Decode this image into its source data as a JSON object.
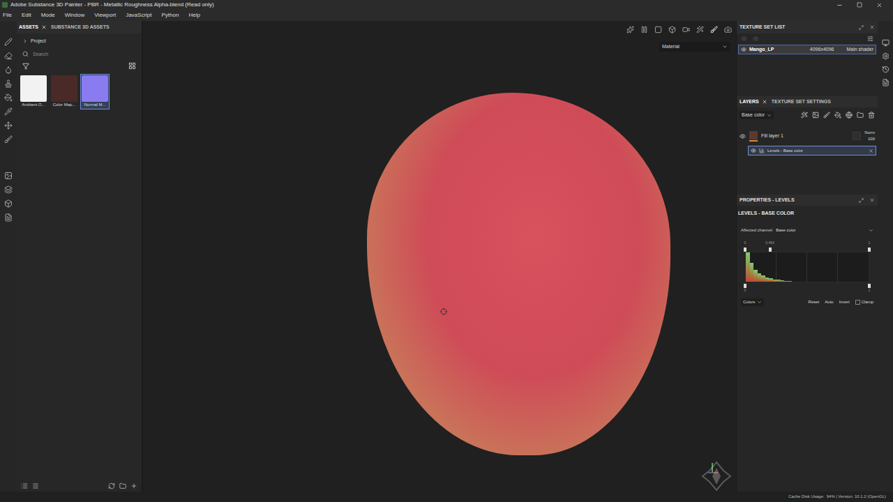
{
  "window": {
    "title": "Adobe Substance 3D Painter - PBR - Metallic Roughness Alpha-blend (Read only)"
  },
  "menu": [
    "File",
    "Edit",
    "Mode",
    "Window",
    "Viewport",
    "JavaScript",
    "Python",
    "Help"
  ],
  "assets_panel": {
    "tabs": [
      {
        "label": "ASSETS",
        "selected": true,
        "closable": true
      },
      {
        "label": "SUBSTANCE 3D ASSETS",
        "selected": false,
        "closable": false
      }
    ],
    "tree": {
      "label": "Project",
      "expanded": false
    },
    "search": {
      "placeholder": "Search"
    },
    "items": [
      {
        "label": "Ambient O...",
        "selected": false,
        "color": "#f2f2f2"
      },
      {
        "label": "Color Map...",
        "selected": false,
        "color": "#4a2a26"
      },
      {
        "label": "Normal M...",
        "selected": true,
        "color": "#8a7cf0"
      }
    ]
  },
  "viewport": {
    "mode": "Material"
  },
  "texture_set_list": {
    "title": "TEXTURE SET LIST",
    "rows": [
      {
        "name": "Mango_LP",
        "resolution": "4096x4096",
        "shader": "Main shader",
        "visible": true,
        "selected": true
      }
    ]
  },
  "layers": {
    "tabs": [
      {
        "label": "LAYERS",
        "selected": true,
        "closable": true
      },
      {
        "label": "TEXTURE SET SETTINGS",
        "selected": false,
        "closable": false
      }
    ],
    "channel": "Base color",
    "items": [
      {
        "kind": "layer",
        "name": "Fill layer 1",
        "visible": true,
        "blend": "Norm",
        "opacity": "100",
        "selected": false
      },
      {
        "kind": "effect",
        "name": "Levels - Base color",
        "visible": true,
        "selected": true
      }
    ]
  },
  "properties": {
    "title": "PROPERTIES - LEVELS",
    "heading": "LEVELS - BASE COLOR",
    "affected_channel_label": "Affected channel:",
    "affected_channel": "Base color",
    "input_markers": [
      {
        "label": "0",
        "level": 0
      },
      {
        "label": "0.454",
        "level": 0.2
      },
      {
        "label": "1",
        "level": 1
      }
    ],
    "output_markers": [
      {
        "label": "0",
        "level": 0
      },
      {
        "label": "1",
        "level": 1
      }
    ],
    "histogram": [
      1,
      0.62,
      0.4,
      0.28,
      0.2,
      0.14,
      0.1,
      0.07,
      0.05,
      0.03,
      0.02,
      0.01,
      0,
      0,
      0,
      0,
      0,
      0,
      0,
      0,
      0,
      0,
      0,
      0,
      0,
      0,
      0,
      0,
      0,
      0,
      0,
      0
    ],
    "mode": "Colors",
    "buttons": [
      "Reset",
      "Auto",
      "Invert"
    ],
    "clamp": {
      "label": "Clamp",
      "checked": false
    }
  },
  "status_bar": {
    "text": "Cache Disk Usage:  94% | Version: 10.1.2 (OpenGL)"
  }
}
